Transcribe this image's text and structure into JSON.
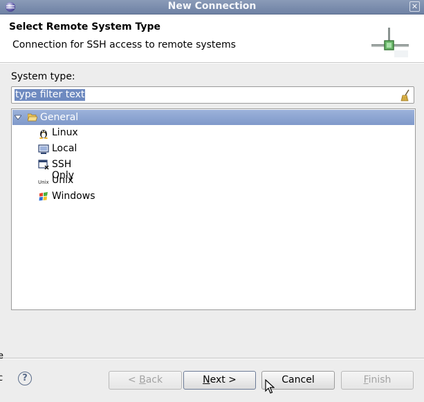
{
  "window": {
    "title": "New Connection"
  },
  "header": {
    "title": "Select Remote System Type",
    "description": "Connection for SSH access to remote systems"
  },
  "filter": {
    "label": "System type:",
    "value": "type filter text"
  },
  "tree": {
    "group": {
      "label": "General",
      "expanded": true,
      "selected": true
    },
    "items": [
      {
        "label": "Linux",
        "icon": "linux-icon"
      },
      {
        "label": "Local",
        "icon": "local-icon"
      },
      {
        "label": "SSH Only",
        "icon": "ssh-icon"
      },
      {
        "label": "Unix",
        "icon": "unix-icon",
        "icon_text": "Unix"
      },
      {
        "label": "Windows",
        "icon": "windows-icon"
      }
    ]
  },
  "buttons": {
    "help": "?",
    "back_prefix": "< ",
    "back_mnemonic": "B",
    "back_suffix": "ack",
    "next_mnemonic": "N",
    "next_suffix": "ext >",
    "cancel": "Cancel",
    "finish_mnemonic": "F",
    "finish_suffix": "inish"
  },
  "edge_glyphs": {
    "upper": "e",
    "lower": "c"
  }
}
